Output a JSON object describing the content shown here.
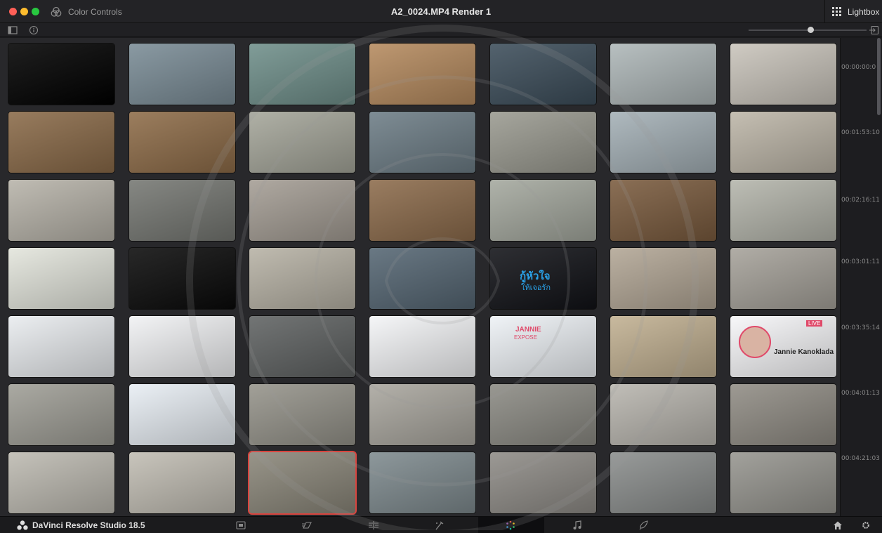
{
  "titlebar": {
    "left_label": "Color Controls",
    "title": "A2_0024.MP4 Render 1",
    "lightbox_label": "Lightbox"
  },
  "timecodes": [
    "00:00:00:0",
    "00:01:53:10",
    "00:02:16:11",
    "00:03:01:11",
    "00:03:35:14",
    "00:04:01:13",
    "00:04:21:03"
  ],
  "thumb_texts": {
    "thai_title_line1": "กู้หัวใจ",
    "thai_title_line2": "ให้เจอรัก",
    "jannie_name": "Jannie Kanoklada",
    "jannie_banner_1": "JANNIE",
    "jannie_banner_2": "EXPOSE",
    "live_badge": "LIVE"
  },
  "thumbnails": [
    {
      "bg": "#000000"
    },
    {
      "bg": "#7a8c96"
    },
    {
      "bg": "#6f8f8a"
    },
    {
      "bg": "#b58a5e"
    },
    {
      "bg": "#3c4d5a"
    },
    {
      "bg": "#aeb7b8"
    },
    {
      "bg": "#c9c4bb"
    },
    {
      "bg": "#8a6a48"
    },
    {
      "bg": "#8e6c48"
    },
    {
      "bg": "#a5a69a"
    },
    {
      "bg": "#6d7d86"
    },
    {
      "bg": "#9a9a90"
    },
    {
      "bg": "#a4b0b6"
    },
    {
      "bg": "#bdb6a8"
    },
    {
      "bg": "#b7b3a9"
    },
    {
      "bg": "#757772"
    },
    {
      "bg": "#a49d94"
    },
    {
      "bg": "#8c6b4b"
    },
    {
      "bg": "#a4a89e"
    },
    {
      "bg": "#7a5b3e"
    },
    {
      "bg": "#b4b5ab"
    },
    {
      "bg": "#e3e5dc"
    },
    {
      "bg": "#0a0a0a"
    },
    {
      "bg": "#b7b2a5"
    },
    {
      "bg": "#556673"
    },
    {
      "bg": "#111217"
    },
    {
      "bg": "#b2a695"
    },
    {
      "bg": "#a6a29a"
    },
    {
      "bg": "#e9ecef"
    },
    {
      "bg": "#f1f2f4"
    },
    {
      "bg": "#5f6262"
    },
    {
      "bg": "#f4f5f7"
    },
    {
      "bg": "#eef2f6"
    },
    {
      "bg": "#c1b091"
    },
    {
      "bg": "#f7f7f9"
    },
    {
      "bg": "#9f9e96"
    },
    {
      "bg": "#e8eef4"
    },
    {
      "bg": "#95938a"
    },
    {
      "bg": "#a9a69e"
    },
    {
      "bg": "#8b8a83"
    },
    {
      "bg": "#b8b5ae"
    },
    {
      "bg": "#908c84"
    },
    {
      "bg": "#bdbab1"
    },
    {
      "bg": "#c1bdb3"
    },
    {
      "bg": "#8a8679"
    },
    {
      "bg": "#7e8a8e"
    },
    {
      "bg": "#8e8b86"
    },
    {
      "bg": "#8a8d8c"
    },
    {
      "bg": "#96958f"
    }
  ],
  "bottombar": {
    "app_name": "DaVinci Resolve Studio 18.5"
  },
  "colors": {
    "selected_border": "#d8453f",
    "accent": "#2a73d6"
  }
}
